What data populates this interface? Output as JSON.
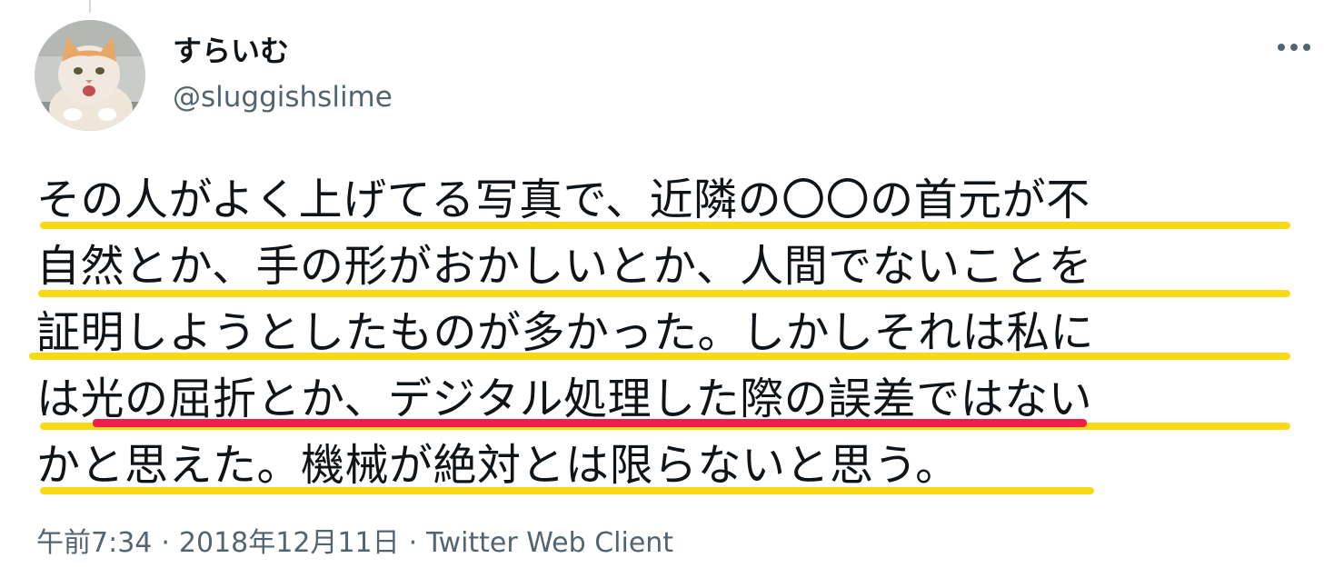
{
  "tweet": {
    "author": {
      "display_name": "すらいむ",
      "handle": "@sluggishslime",
      "avatar_icon": "cat-avatar-icon"
    },
    "more_icon": "more-options-icon",
    "lines": [
      "その人がよく上げてる写真で、近隣の〇〇の首元が不",
      "自然とか、手の形がおかしいとか、人間でないことを",
      "証明しようとしたものが多かった。しかしそれは私に",
      "は光の屈折とか、デジタル処理した際の誤差ではない",
      "かと思えた。機械が絶対とは限らないと思う。"
    ],
    "timestamp": "午前7:34",
    "date": "2018年12月11日",
    "separator": "·",
    "source": "Twitter Web Client"
  },
  "colors": {
    "highlight_yellow": "#f7d916",
    "highlight_red": "#f01e4b",
    "text_primary": "#0f1419",
    "text_secondary": "#536471"
  }
}
